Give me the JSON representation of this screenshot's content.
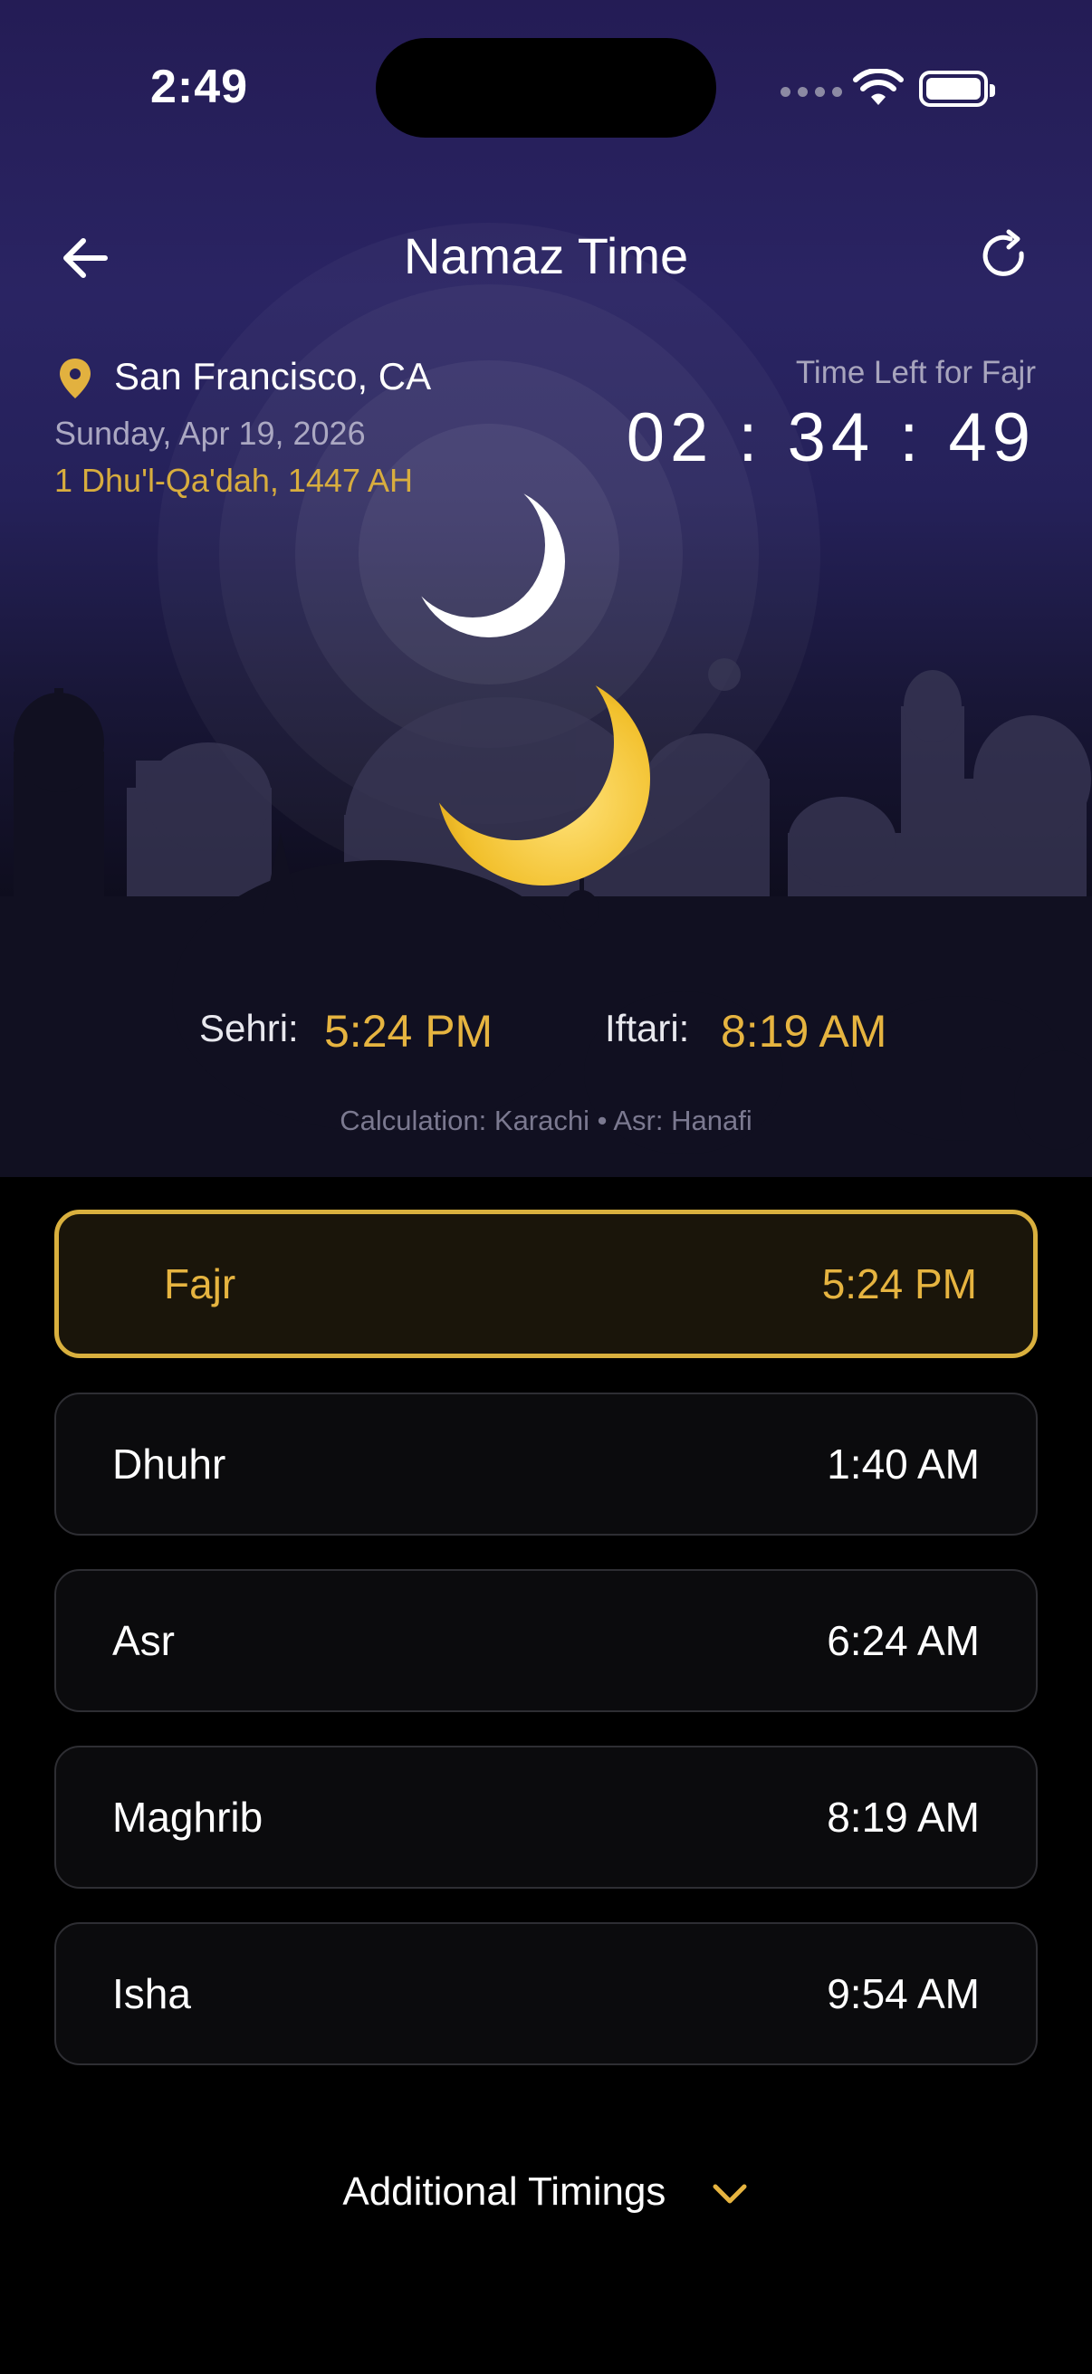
{
  "status_bar": {
    "time": "2:49"
  },
  "header": {
    "title": "Namaz Time",
    "back_icon": "arrow-left-icon",
    "refresh_icon": "refresh-icon"
  },
  "location": {
    "city": "San Francisco, CA",
    "date": "Sunday, Apr 19, 2026",
    "hijri": "1 Dhu'l-Qa'dah, 1447 AH"
  },
  "countdown": {
    "label": "Time Left for Fajr",
    "value": "02 : 34 : 49"
  },
  "fasting": {
    "sehri_label": "Sehri:",
    "sehri_time": "5:24 PM",
    "iftari_label": "Iftari:",
    "iftari_time": "8:19 AM"
  },
  "calculation": "Calculation: Karachi • Asr: Hanafi",
  "prayers": [
    {
      "name": "Fajr",
      "time": "5:24 PM",
      "active": true
    },
    {
      "name": "Dhuhr",
      "time": "1:40 AM",
      "active": false
    },
    {
      "name": "Asr",
      "time": "6:24 AM",
      "active": false
    },
    {
      "name": "Maghrib",
      "time": "8:19 AM",
      "active": false
    },
    {
      "name": "Isha",
      "time": "9:54 AM",
      "active": false
    }
  ],
  "additional": {
    "label": "Additional Timings",
    "icon": "chevron-down-icon"
  },
  "colors": {
    "accent": "#e6b440",
    "background": "#000000",
    "hero_top": "#241c55"
  }
}
